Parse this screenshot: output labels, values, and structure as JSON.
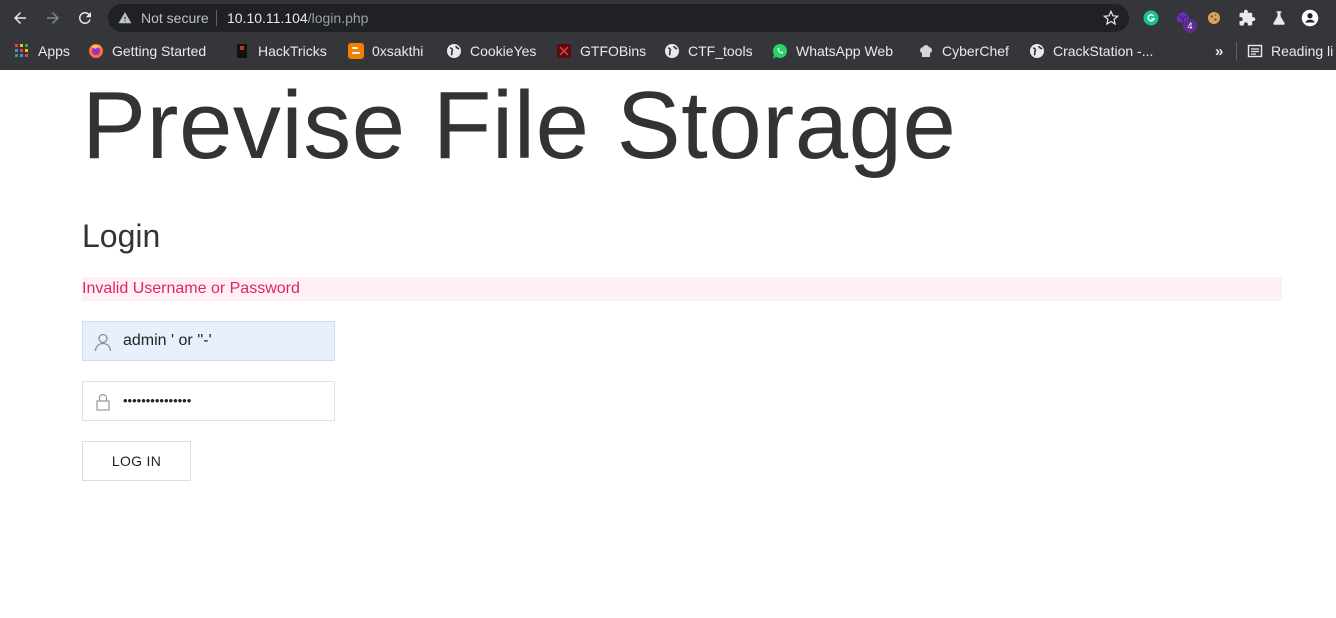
{
  "browser": {
    "security_label": "Not secure",
    "url_host": "10.10.11.104",
    "url_path": "/login.php",
    "extension_badge": "4"
  },
  "bookmarks": {
    "items": [
      {
        "label": "Apps",
        "icon": "apps-grid-icon"
      },
      {
        "label": "Getting Started",
        "icon": "firefox-icon"
      },
      {
        "label": "HackTricks",
        "icon": "hacktricks-icon"
      },
      {
        "label": "0xsakthi",
        "icon": "blogger-icon"
      },
      {
        "label": "CookieYes",
        "icon": "globe-icon"
      },
      {
        "label": "GTFOBins",
        "icon": "gtfobins-icon"
      },
      {
        "label": "CTF_tools",
        "icon": "globe-icon"
      },
      {
        "label": "WhatsApp Web",
        "icon": "whatsapp-icon"
      },
      {
        "label": "CyberChef",
        "icon": "chef-hat-icon"
      },
      {
        "label": "CrackStation -...",
        "icon": "globe-icon"
      },
      {
        "label": "Reading li",
        "icon": "reading-list-icon"
      }
    ],
    "more_label": "»"
  },
  "page": {
    "site_title": "Previse File Storage",
    "heading": "Login",
    "error_message": "Invalid Username or Password",
    "username_value": "admin ' or ''-'",
    "password_masked": "•••••••••••••••",
    "login_button": "LOG IN"
  },
  "colors": {
    "chrome": "#35363a",
    "omnibox": "#202124",
    "error_text": "#e1236b",
    "error_bg": "#fff1f3",
    "autofill_bg": "#e8f0fe",
    "title_text": "#333333"
  }
}
